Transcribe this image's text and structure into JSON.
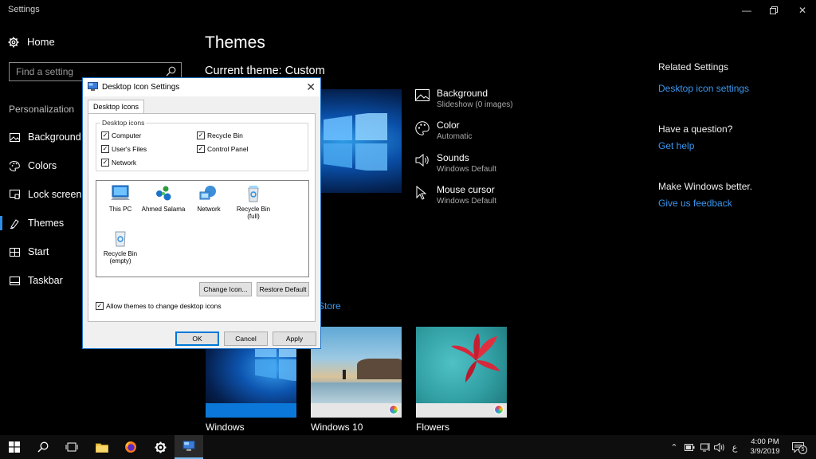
{
  "window": {
    "title": "Settings"
  },
  "sidebar": {
    "home_label": "Home",
    "search_placeholder": "Find a setting",
    "section_label": "Personalization",
    "items": [
      {
        "label": "Background",
        "icon": "image-icon"
      },
      {
        "label": "Colors",
        "icon": "palette-icon"
      },
      {
        "label": "Lock screen",
        "icon": "lock-screen-icon"
      },
      {
        "label": "Themes",
        "icon": "themes-icon",
        "active": true
      },
      {
        "label": "Start",
        "icon": "start-icon"
      },
      {
        "label": "Taskbar",
        "icon": "taskbar-icon"
      }
    ]
  },
  "main": {
    "title": "Themes",
    "current_theme": "Current theme: Custom",
    "properties": [
      {
        "name": "Background",
        "value": "Slideshow (0 images)",
        "icon": "image-icon"
      },
      {
        "name": "Color",
        "value": "Automatic",
        "icon": "palette-icon"
      },
      {
        "name": "Sounds",
        "value": "Windows Default",
        "icon": "speaker-icon"
      },
      {
        "name": "Mouse cursor",
        "value": "Windows Default",
        "icon": "cursor-icon"
      }
    ],
    "store_link_partial": "Store",
    "themes": [
      {
        "label": "Windows"
      },
      {
        "label": "Windows 10"
      },
      {
        "label": "Flowers"
      }
    ]
  },
  "related": {
    "heading": "Related Settings",
    "link": "Desktop icon settings",
    "question_heading": "Have a question?",
    "help_link": "Get help",
    "feedback_heading": "Make Windows better.",
    "feedback_link": "Give us feedback"
  },
  "dialog": {
    "title": "Desktop Icon Settings",
    "tab": "Desktop Icons",
    "group_label": "Desktop icons",
    "checkboxes": {
      "computer": {
        "label": "Computer",
        "checked": true
      },
      "recycle_bin": {
        "label": "Recycle Bin",
        "checked": true
      },
      "users_files": {
        "label": "User's Files",
        "checked": true
      },
      "control_panel": {
        "label": "Control Panel",
        "checked": true
      },
      "network": {
        "label": "Network",
        "checked": true
      }
    },
    "icons": {
      "this_pc": "This PC",
      "user": "Ahmed Salama",
      "network": "Network",
      "recycle_full_1": "Recycle Bin",
      "recycle_full_2": "(full)",
      "recycle_empty_1": "Recycle Bin",
      "recycle_empty_2": "(empty)"
    },
    "change_icon": "Change Icon...",
    "restore_default": "Restore Default",
    "allow_themes": "Allow themes to change desktop icons",
    "ok": "OK",
    "cancel": "Cancel",
    "apply": "Apply"
  },
  "taskbar": {
    "time": "4:00 PM",
    "date": "3/9/2019",
    "language": "ع",
    "notification_count": "5"
  },
  "colors": {
    "accent": "#3a97ee",
    "background": "#000000",
    "taskbar": "#0e0e0e"
  }
}
